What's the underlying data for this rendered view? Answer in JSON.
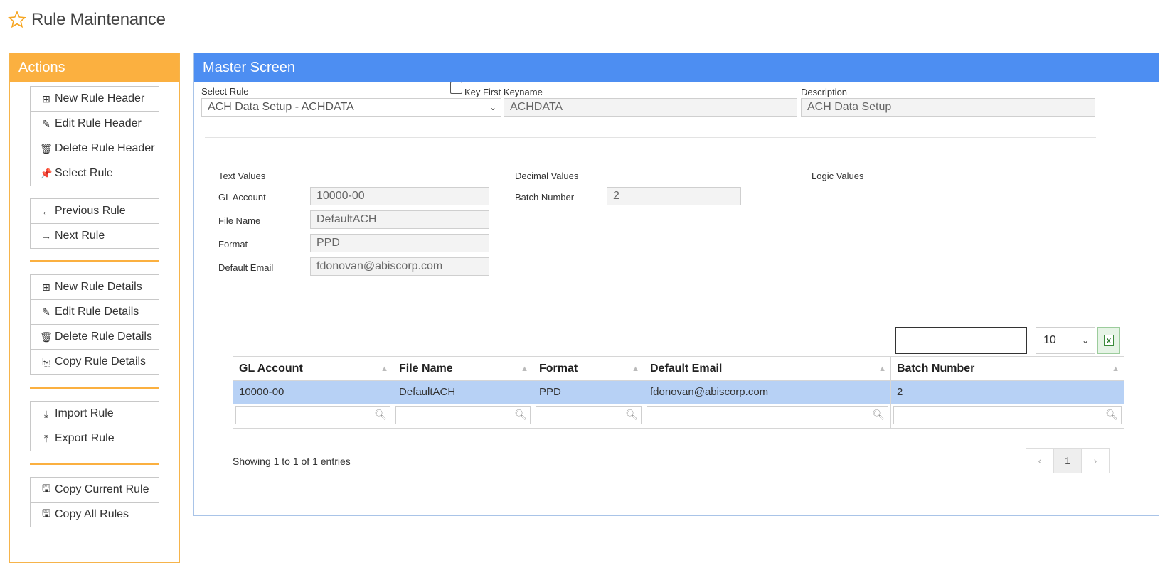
{
  "page": {
    "title": "Rule Maintenance"
  },
  "colors": {
    "actions_accent": "#fbb040",
    "master_accent": "#4d8ef2",
    "selected_row": "#b7d1f5"
  },
  "actions": {
    "title": "Actions",
    "groups": [
      [
        {
          "label": "New Rule Header",
          "icon": "plus-square-icon"
        },
        {
          "label": "Edit Rule Header",
          "icon": "pencil-icon"
        },
        {
          "label": "Delete Rule Header",
          "icon": "trash-icon"
        },
        {
          "label": "Select Rule",
          "icon": "pin-icon"
        }
      ],
      [
        {
          "label": "Previous Rule",
          "icon": "arrow-left-icon"
        },
        {
          "label": "Next Rule",
          "icon": "arrow-right-icon"
        }
      ],
      [
        {
          "label": "New Rule Details",
          "icon": "plus-square-icon"
        },
        {
          "label": "Edit Rule Details",
          "icon": "pencil-icon"
        },
        {
          "label": "Delete Rule Details",
          "icon": "trash-icon"
        },
        {
          "label": "Copy Rule Details",
          "icon": "copy-icon"
        }
      ],
      [
        {
          "label": "Import Rule",
          "icon": "download-icon"
        },
        {
          "label": "Export Rule",
          "icon": "upload-icon"
        }
      ],
      [
        {
          "label": "Copy Current Rule",
          "icon": "save-icon"
        },
        {
          "label": "Copy All Rules",
          "icon": "save-icon"
        }
      ]
    ]
  },
  "master": {
    "title": "Master Screen",
    "select_rule_label": "Select Rule",
    "select_rule_value": "ACH Data Setup - ACHDATA",
    "key_first_label": "Key First Keyname",
    "keyname_value": "ACHDATA",
    "description_label": "Description",
    "description_value": "ACH Data Setup",
    "text_values_label": "Text Values",
    "decimal_values_label": "Decimal Values",
    "logic_values_label": "Logic Values",
    "text_fields": [
      {
        "label": "GL Account",
        "value": "10000-00"
      },
      {
        "label": "File Name",
        "value": "DefaultACH"
      },
      {
        "label": "Format",
        "value": "PPD"
      },
      {
        "label": "Default Email",
        "value": "fdonovan@abiscorp.com"
      }
    ],
    "decimal_fields": [
      {
        "label": "Batch Number",
        "value": "2"
      }
    ]
  },
  "table": {
    "page_length": "10",
    "columns": [
      "GL Account",
      "File Name",
      "Format",
      "Default Email",
      "Batch Number"
    ],
    "rows": [
      [
        "10000-00",
        "DefaultACH",
        "PPD",
        "fdonovan@abiscorp.com",
        "2"
      ]
    ],
    "info": "Showing 1 to 1 of 1 entries",
    "pager": {
      "prev": "‹",
      "current": "1",
      "next": "›"
    }
  }
}
